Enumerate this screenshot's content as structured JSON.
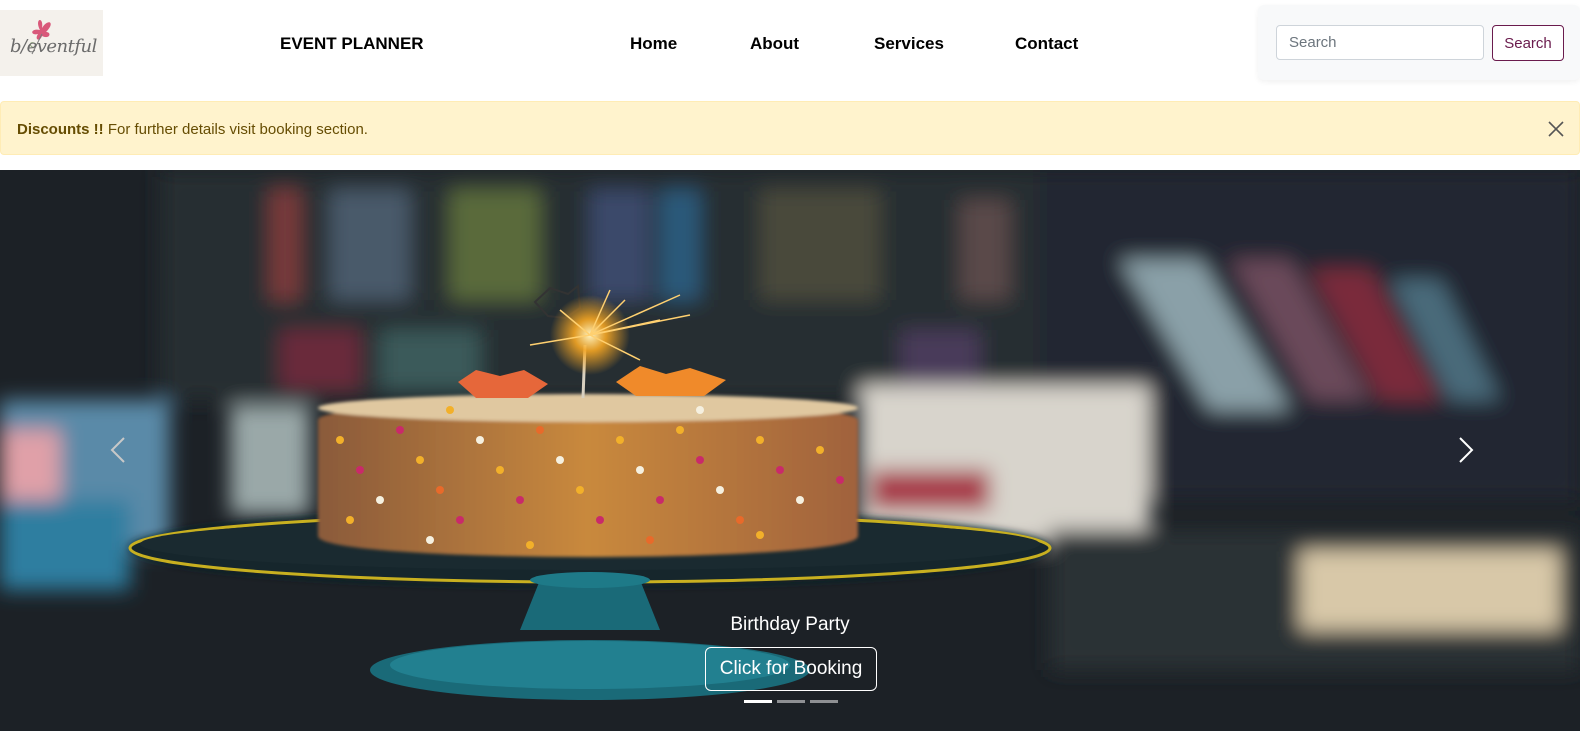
{
  "header": {
    "logo_text": "b/eventful",
    "brand": "EVENT PLANNER",
    "nav": [
      {
        "label": "Home"
      },
      {
        "label": "About"
      },
      {
        "label": "Services"
      },
      {
        "label": "Contact"
      }
    ],
    "search": {
      "placeholder": "Search",
      "button_label": "Search"
    }
  },
  "alert": {
    "title": "Discounts !!",
    "message": "For further details visit booking section.",
    "icon": "close-icon"
  },
  "carousel": {
    "caption": "Birthday Party",
    "button_label": "Click for Booking",
    "slide_count": 3,
    "active_slide": 1,
    "prev_icon": "chevron-left-icon",
    "next_icon": "chevron-right-icon"
  },
  "colors": {
    "accent": "#6a1b4d",
    "alert_bg": "#fff3cd",
    "alert_text": "#664d03"
  }
}
